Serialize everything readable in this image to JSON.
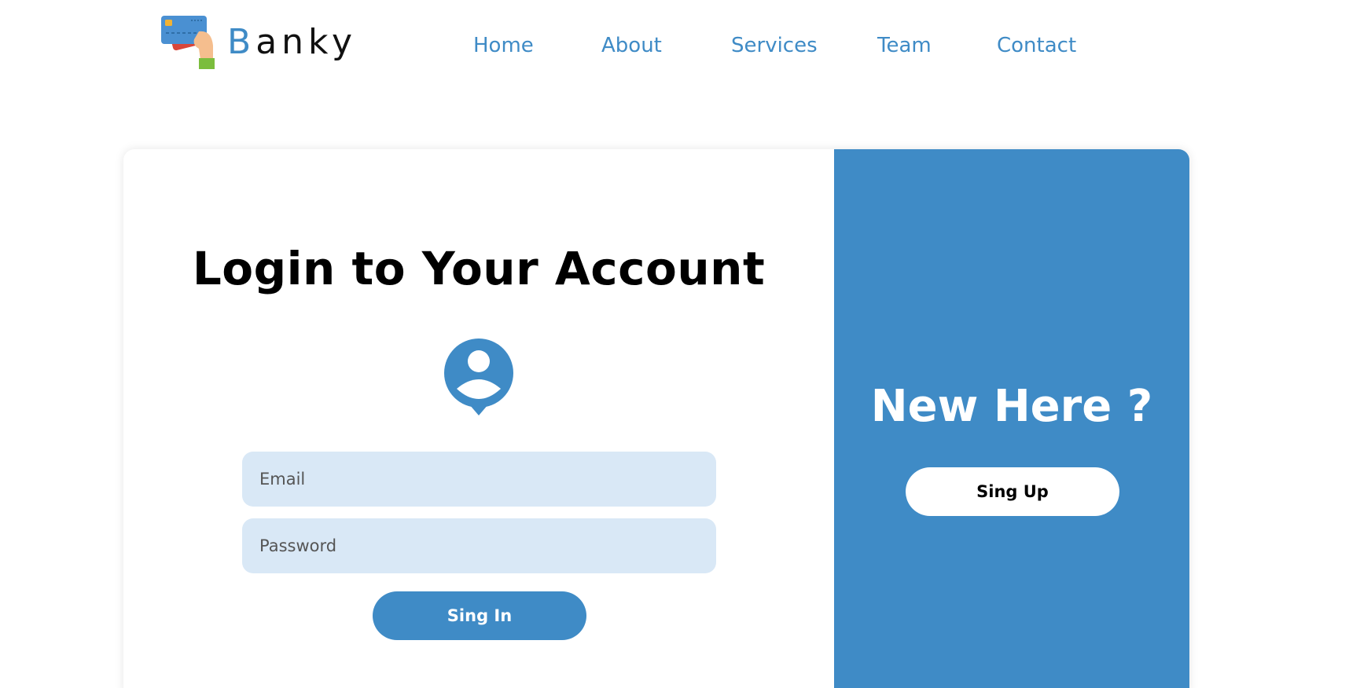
{
  "brand": {
    "first_letter": "B",
    "rest": "anky"
  },
  "nav": {
    "items": [
      {
        "label": "Home"
      },
      {
        "label": "About"
      },
      {
        "label": "Services"
      },
      {
        "label": "Team"
      },
      {
        "label": "Contact"
      }
    ]
  },
  "login": {
    "title": "Login to Your Account",
    "email_placeholder": "Email",
    "password_placeholder": "Password",
    "signin_label": "Sing In"
  },
  "signup": {
    "heading": "New Here ?",
    "button_label": "Sing Up"
  },
  "colors": {
    "accent": "#3f8bc6",
    "field_bg": "#d9e8f6"
  },
  "icons": {
    "logo": "hand-holding-cards-icon",
    "user": "user-location-icon"
  }
}
